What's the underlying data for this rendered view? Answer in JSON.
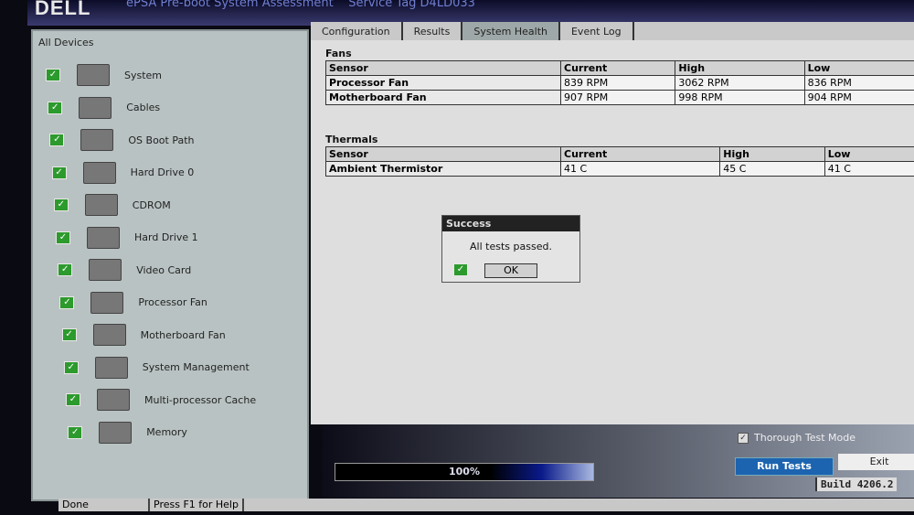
{
  "header": {
    "logo": "DELL",
    "title": "ePSA Pre-boot System Assessment",
    "service_tag": "Service Tag D4LD033"
  },
  "devices": {
    "header": "All Devices",
    "items": [
      "System",
      "Cables",
      "OS Boot Path",
      "Hard Drive 0",
      "CDROM",
      "Hard Drive 1",
      "Video Card",
      "Processor Fan",
      "Motherboard Fan",
      "System Management",
      "Multi-processor Cache",
      "Memory"
    ]
  },
  "tabs": [
    "Configuration",
    "Results",
    "System Health",
    "Event Log"
  ],
  "fans": {
    "title": "Fans",
    "columns": [
      "Sensor",
      "Current",
      "High",
      "Low"
    ],
    "rows": [
      [
        "Processor Fan",
        "839 RPM",
        "3062 RPM",
        "836 RPM"
      ],
      [
        "Motherboard Fan",
        "907 RPM",
        "998 RPM",
        "904 RPM"
      ]
    ]
  },
  "thermals": {
    "title": "Thermals",
    "columns": [
      "Sensor",
      "Current",
      "High",
      "Low"
    ],
    "rows": [
      [
        "Ambient Thermistor",
        "41 C",
        "45 C",
        "41 C"
      ]
    ]
  },
  "dialog": {
    "title": "Success",
    "message": "All tests passed.",
    "ok": "OK"
  },
  "progress": {
    "label": "100%",
    "value": 100
  },
  "thorough": "Thorough Test Mode",
  "buttons": {
    "run": "Run Tests",
    "exit": "Exit"
  },
  "build": "Build  4206.2",
  "status": {
    "state": "Done",
    "help": "Press F1 for Help"
  }
}
